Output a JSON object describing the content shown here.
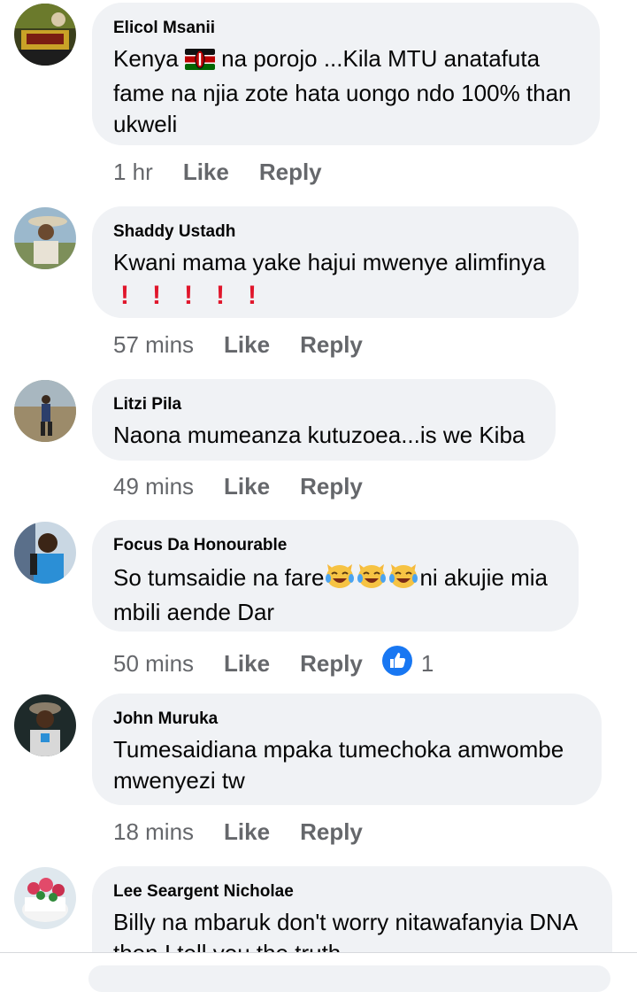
{
  "labels": {
    "like": "Like",
    "reply": "Reply"
  },
  "comments": [
    {
      "author": "Elicol Msanii",
      "text_parts": [
        "Kenya ",
        " na porojo ...Kila MTU anatafuta fame na njia zote hata uongo ndo 100% than ukweli"
      ],
      "time": "1 hr",
      "avatar_icon": "profile-photo"
    },
    {
      "author": "Shaddy Ustadh",
      "text": "Kwani mama yake hajui mwenye alimfinya",
      "time": "57 mins",
      "avatar_icon": "profile-photo"
    },
    {
      "author": "Litzi Pila",
      "text": "Naona mumeanza kutuzoea...is we Kiba",
      "time": "49 mins",
      "avatar_icon": "profile-photo"
    },
    {
      "author": "Focus Da Honourable",
      "text_parts": [
        "So tumsaidie na fare",
        "ni akujie mia mbili aende Dar"
      ],
      "time": "50 mins",
      "reaction_count": "1",
      "avatar_icon": "profile-photo"
    },
    {
      "author": "John Muruka",
      "text": "Tumesaidiana mpaka tumechoka amwombe mwenyezi tw",
      "time": "18 mins",
      "avatar_icon": "profile-photo"
    },
    {
      "author": "Lee Seargent Nicholae",
      "text": "Billy na mbaruk don't worry nitawafanyia DNA then I tell you the truth",
      "avatar_icon": "profile-photo"
    }
  ],
  "colors": {
    "bubble": "#f0f2f5",
    "meta": "#65676b",
    "like_badge": "#1877f2",
    "exclamation": "#e0162b"
  }
}
